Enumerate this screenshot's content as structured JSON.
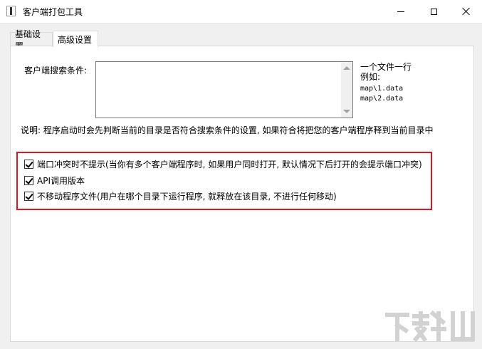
{
  "window": {
    "title": "客户端打包工具",
    "app_icon": "app-icon",
    "minimize_icon": "minimize-icon",
    "maximize_icon": "maximize-icon",
    "close_icon": "close-icon"
  },
  "tabs": [
    {
      "label": "基础设置",
      "active": false
    },
    {
      "label": "高级设置",
      "active": true
    }
  ],
  "search": {
    "label": "客户端搜索条件:",
    "value": "",
    "hint_line1": "一个文件一行",
    "hint_line2": "例如:",
    "example1": "map\\1.data",
    "example2": "map\\2.data"
  },
  "description": "说明: 程序启动时会先判断当前的目录是否符合搜索条件的设置, 如果符合将把您的客户端程序释到当前目录中",
  "options": [
    {
      "label": "端口冲突时不提示(当你有多个客户端程序时, 如果用户同时打开, 默认情况下后打开的会提示端口冲突)",
      "checked": true
    },
    {
      "label": "API调用版本",
      "checked": true
    },
    {
      "label": "不移动程序文件(用户在哪个目录下运行程序, 就释放在该目录, 不进行任何移动)",
      "checked": true
    }
  ],
  "colors": {
    "highlight_border": "#e0161e"
  }
}
